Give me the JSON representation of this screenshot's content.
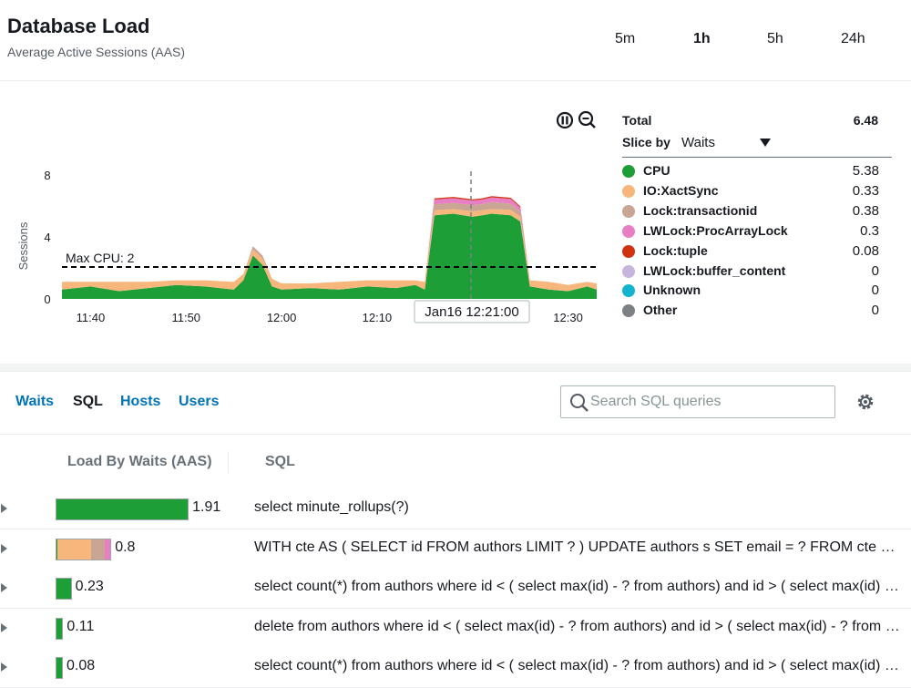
{
  "header": {
    "title": "Database Load",
    "subtitle": "Average Active Sessions (AAS)",
    "time_ranges": [
      "5m",
      "1h",
      "5h",
      "24h"
    ],
    "active_range": "1h"
  },
  "chart": {
    "ylabel": "Sessions",
    "y_ticks": [
      "8",
      "4",
      "0"
    ],
    "x_ticks": [
      "11:40",
      "11:50",
      "12:00",
      "12:10",
      "12:30"
    ],
    "max_cpu_label": "Max CPU: 2",
    "tooltip": "Jan16 12:21:00",
    "icons": [
      "pause-icon",
      "zoom-out-icon"
    ]
  },
  "chart_data": {
    "type": "area",
    "ylabel": "Sessions",
    "ylim": [
      0,
      10
    ],
    "threshold": {
      "label": "Max CPU: 2",
      "value": 2
    },
    "x": [
      "11:37",
      "11:40",
      "11:43",
      "11:46",
      "11:49",
      "11:52",
      "11:55",
      "11:56",
      "11:57",
      "11:58",
      "11:59",
      "12:00",
      "12:03",
      "12:06",
      "12:09",
      "12:12",
      "12:14",
      "12:15",
      "12:16",
      "12:18",
      "12:20",
      "12:21",
      "12:22",
      "12:24",
      "12:25",
      "12:26",
      "12:28",
      "12:30",
      "12:32",
      "12:33"
    ],
    "series": [
      {
        "name": "CPU",
        "color": "#1d9e37",
        "values": [
          0.6,
          0.8,
          0.5,
          0.7,
          0.9,
          0.8,
          0.6,
          1.2,
          2.8,
          2.2,
          0.8,
          0.6,
          0.7,
          0.6,
          0.8,
          0.7,
          0.9,
          0.6,
          5.4,
          5.5,
          5.3,
          5.4,
          5.5,
          5.4,
          5.0,
          0.8,
          0.6,
          0.5,
          0.8,
          0.6
        ]
      },
      {
        "name": "IO:XactSync",
        "color": "#f7b77c",
        "values": [
          0.5,
          0.3,
          0.6,
          0.4,
          0.3,
          0.4,
          0.5,
          0.4,
          0.4,
          0.4,
          0.5,
          0.4,
          0.3,
          0.5,
          0.4,
          0.5,
          0.3,
          0.5,
          0.33,
          0.3,
          0.35,
          0.33,
          0.3,
          0.35,
          0.3,
          0.4,
          0.5,
          0.4,
          0.3,
          0.4
        ]
      },
      {
        "name": "Lock:transactionid",
        "color": "#c9a594",
        "values": [
          0,
          0,
          0,
          0,
          0,
          0,
          0,
          0,
          0.2,
          0.2,
          0,
          0,
          0,
          0,
          0,
          0,
          0,
          0,
          0.38,
          0.4,
          0.4,
          0.38,
          0.45,
          0.4,
          0.35,
          0,
          0,
          0,
          0,
          0
        ]
      },
      {
        "name": "LWLock:ProcArrayLock",
        "color": "#e87fc4",
        "values": [
          0,
          0,
          0,
          0,
          0,
          0,
          0,
          0,
          0,
          0,
          0,
          0,
          0,
          0,
          0,
          0,
          0,
          0,
          0.3,
          0.3,
          0.3,
          0.3,
          0.3,
          0.3,
          0.25,
          0,
          0,
          0,
          0,
          0
        ]
      },
      {
        "name": "Lock:tuple",
        "color": "#d13212",
        "values": [
          0,
          0,
          0,
          0,
          0,
          0,
          0,
          0,
          0,
          0,
          0,
          0,
          0,
          0,
          0,
          0,
          0,
          0,
          0.08,
          0.08,
          0.08,
          0.08,
          0.08,
          0.08,
          0.08,
          0,
          0,
          0,
          0,
          0
        ]
      },
      {
        "name": "LWLock:buffer_content",
        "color": "#c7b5e0",
        "values": [
          0,
          0,
          0,
          0,
          0,
          0,
          0,
          0,
          0,
          0,
          0,
          0,
          0,
          0,
          0,
          0,
          0,
          0,
          0,
          0,
          0,
          0,
          0,
          0,
          0,
          0,
          0,
          0,
          0,
          0
        ]
      }
    ]
  },
  "legend": {
    "total_label": "Total",
    "total_value": "6.48",
    "slice_label": "Slice by",
    "slice_value": "Waits",
    "items": [
      {
        "name": "CPU",
        "value": "5.38",
        "color": "#1d9e37"
      },
      {
        "name": "IO:XactSync",
        "value": "0.33",
        "color": "#f7b77c"
      },
      {
        "name": "Lock:transactionid",
        "value": "0.38",
        "color": "#c9a594"
      },
      {
        "name": "LWLock:ProcArrayLock",
        "value": "0.3",
        "color": "#e87fc4"
      },
      {
        "name": "Lock:tuple",
        "value": "0.08",
        "color": "#d13212"
      },
      {
        "name": "LWLock:buffer_content",
        "value": "0",
        "color": "#c7b5e0"
      },
      {
        "name": "Unknown",
        "value": "0",
        "color": "#12b5cb"
      },
      {
        "name": "Other",
        "value": "0",
        "color": "#7d8084"
      }
    ]
  },
  "tabs": [
    {
      "label": "Waits",
      "active": false
    },
    {
      "label": "SQL",
      "active": true
    },
    {
      "label": "Hosts",
      "active": false
    },
    {
      "label": "Users",
      "active": false
    }
  ],
  "search": {
    "placeholder": "Search SQL queries"
  },
  "table": {
    "headers": [
      "Load By Waits (AAS)",
      "SQL"
    ],
    "rows": [
      {
        "load": "1.91",
        "load_value": 1.91,
        "segments": [
          {
            "color": "#1d9e37",
            "value": 1.91
          }
        ],
        "sql": "select minute_rollups(?)"
      },
      {
        "load": "0.8",
        "load_value": 0.8,
        "segments": [
          {
            "color": "#1d9e37",
            "value": 0.02
          },
          {
            "color": "#f7b77c",
            "value": 0.5
          },
          {
            "color": "#c9a594",
            "value": 0.2
          },
          {
            "color": "#e87fc4",
            "value": 0.08
          }
        ],
        "sql": "WITH cte AS ( SELECT id FROM authors LIMIT ? ) UPDATE authors s SET email = ? FROM cte WHERE s.id = cte.id"
      },
      {
        "load": "0.23",
        "load_value": 0.23,
        "segments": [
          {
            "color": "#1d9e37",
            "value": 0.23
          }
        ],
        "sql": "select count(*) from authors where id < ( select max(id) - ? from authors) and id > ( select max(id) - ? from authors)"
      },
      {
        "load": "0.11",
        "load_value": 0.11,
        "segments": [
          {
            "color": "#1d9e37",
            "value": 0.11
          }
        ],
        "sql": "delete from authors where id < ( select max(id) - ? from authors) and id > ( select max(id) - ? from authors)"
      },
      {
        "load": "0.08",
        "load_value": 0.08,
        "segments": [
          {
            "color": "#1d9e37",
            "value": 0.08
          }
        ],
        "sql": "select count(*) from authors where id < ( select max(id) - ? from authors) and id > ( select max(id) - ? from authors)"
      }
    ]
  }
}
